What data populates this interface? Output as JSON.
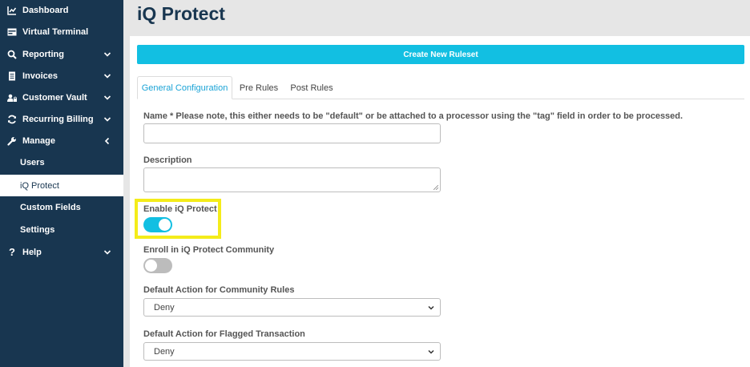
{
  "sidebar": {
    "items": [
      {
        "label": "Dashboard",
        "icon": "chart-line-icon"
      },
      {
        "label": "Virtual Terminal",
        "icon": "terminal-icon"
      },
      {
        "label": "Reporting",
        "icon": "search-icon"
      },
      {
        "label": "Invoices",
        "icon": "invoice-icon"
      },
      {
        "label": "Customer Vault",
        "icon": "users-lock-icon"
      },
      {
        "label": "Recurring Billing",
        "icon": "sync-icon"
      },
      {
        "label": "Manage",
        "icon": "wrench-icon"
      }
    ],
    "manage_sub": [
      {
        "label": "Users"
      },
      {
        "label": "iQ Protect"
      },
      {
        "label": "Custom Fields"
      },
      {
        "label": "Settings"
      }
    ],
    "help": {
      "label": "Help",
      "icon": "question-icon"
    }
  },
  "header": {
    "title": "iQ Protect"
  },
  "main": {
    "create_button": "Create New Ruleset",
    "tabs": [
      {
        "label": "General Configuration"
      },
      {
        "label": "Pre Rules"
      },
      {
        "label": "Post Rules"
      }
    ],
    "form": {
      "name_label": "Name * Please note, this either needs to be \"default\" or be attached to a processor using the \"tag\" field in order to be processed.",
      "name_value": "",
      "description_label": "Description",
      "description_value": "",
      "enable_label": "Enable iQ Protect",
      "enable_on": true,
      "enroll_label": "Enroll in iQ Protect Community",
      "enroll_on": false,
      "community_action_label": "Default Action for Community Rules",
      "community_action_value": "Deny",
      "flagged_action_label": "Default Action for Flagged Transaction",
      "flagged_action_value": "Deny"
    }
  },
  "colors": {
    "sidebar": "#183650",
    "accent": "#12bfe2",
    "highlight": "#f4ec1a"
  }
}
